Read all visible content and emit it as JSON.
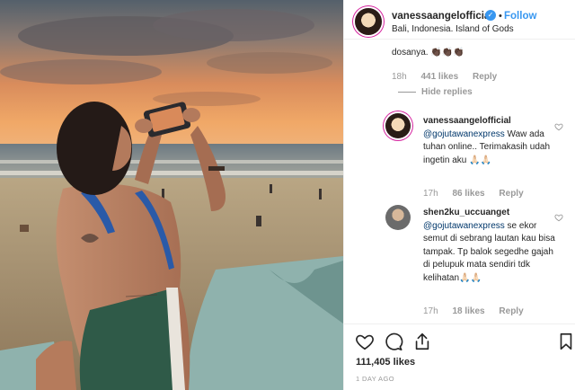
{
  "post": {
    "username": "vanessaangelofficial",
    "follow_label": "Follow",
    "separator": "•",
    "location": "Bali, Indonesia. Island of Gods"
  },
  "comments": {
    "partial_text": "dosanya. 👏🏿👏🏿👏🏿",
    "first_meta": {
      "time": "18h",
      "likes": "441 likes",
      "reply": "Reply"
    },
    "hide_replies": "Hide replies",
    "replies": [
      {
        "username": "vanessaangelofficial",
        "mention": "@gojutawanexpress",
        "text": " Waw ada tuhan online.. Terimakasih udah ingetin aku 🙏🏻🙏🏻",
        "time": "17h",
        "likes": "86 likes",
        "reply": "Reply"
      },
      {
        "username": "shen2ku_uccuanget",
        "mention": "@gojutawanexpress",
        "text": " se ekor semut di sebrang lautan kau bisa tampak. Tp balok segedhe gajah di pelupuk mata sendiri tdk kelihatan🙏🏻🙏🏻",
        "time": "17h",
        "likes": "18 likes",
        "reply": "Reply"
      }
    ]
  },
  "footer": {
    "likes_count": "111,405 likes",
    "date": "1 DAY AGO"
  },
  "icons": [
    "verified-badge-icon",
    "heart-icon",
    "comment-icon",
    "share-icon",
    "bookmark-icon"
  ],
  "colors": {
    "accent": "#3897f0",
    "muted": "#999999",
    "text": "#262626",
    "sunset": "#e8925a"
  }
}
